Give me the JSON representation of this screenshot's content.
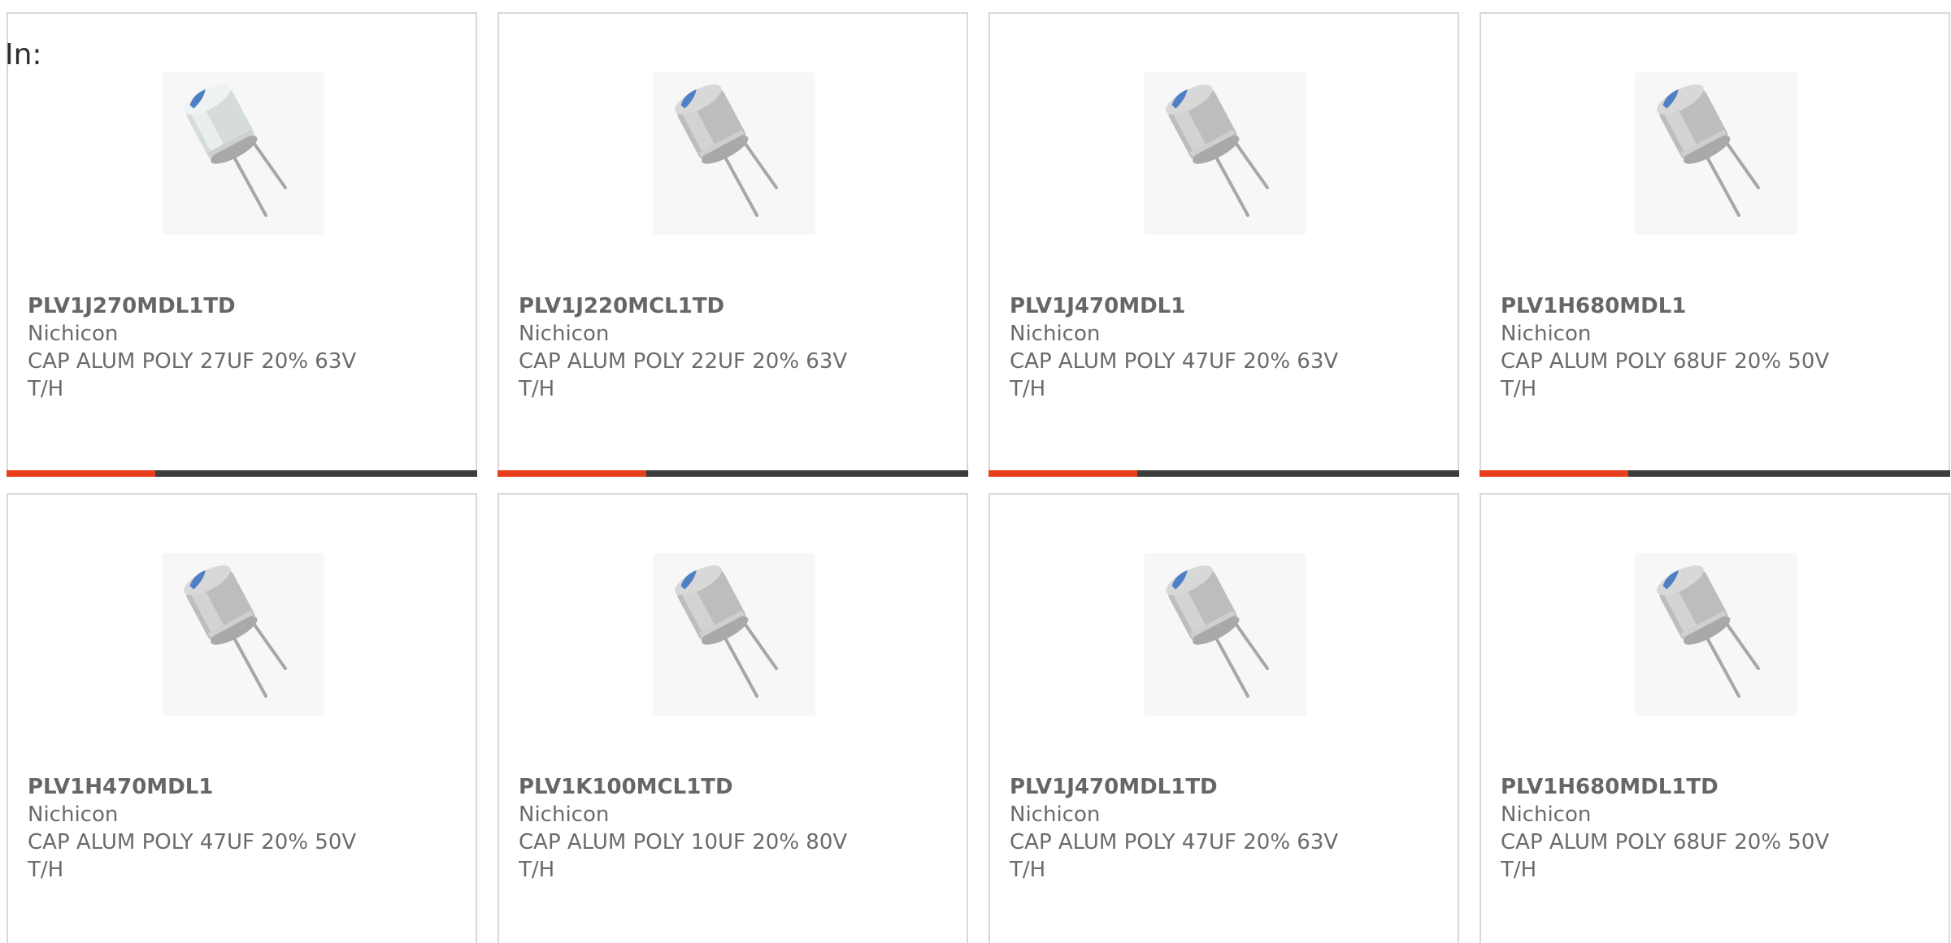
{
  "header": {
    "label": "In:"
  },
  "accent_color": "#e8401c",
  "bar_color": "#3d3d3d",
  "rows": [
    [
      {
        "part": "PLV1J270MDL1TD",
        "maker": "Nichicon",
        "desc": "CAP ALUM POLY 27UF 20% 63V",
        "mount": "T/H",
        "icon": "capacitor-image",
        "sleeve": "light"
      },
      {
        "part": "PLV1J220MCL1TD",
        "maker": "Nichicon",
        "desc": "CAP ALUM POLY 22UF 20% 63V",
        "mount": "T/H",
        "icon": "capacitor-image",
        "sleeve": "gray"
      },
      {
        "part": "PLV1J470MDL1",
        "maker": "Nichicon",
        "desc": "CAP ALUM POLY 47UF 20% 63V",
        "mount": "T/H",
        "icon": "capacitor-image",
        "sleeve": "gray"
      },
      {
        "part": "PLV1H680MDL1",
        "maker": "Nichicon",
        "desc": "CAP ALUM POLY 68UF 20% 50V",
        "mount": "T/H",
        "icon": "capacitor-image",
        "sleeve": "gray"
      }
    ],
    [
      {
        "part": "PLV1H470MDL1",
        "maker": "Nichicon",
        "desc": "CAP ALUM POLY 47UF 20% 50V",
        "mount": "T/H",
        "icon": "capacitor-image",
        "sleeve": "gray"
      },
      {
        "part": "PLV1K100MCL1TD",
        "maker": "Nichicon",
        "desc": "CAP ALUM POLY 10UF 20% 80V",
        "mount": "T/H",
        "icon": "capacitor-image",
        "sleeve": "gray"
      },
      {
        "part": "PLV1J470MDL1TD",
        "maker": "Nichicon",
        "desc": "CAP ALUM POLY 47UF 20% 63V",
        "mount": "T/H",
        "icon": "capacitor-image",
        "sleeve": "gray"
      },
      {
        "part": "PLV1H680MDL1TD",
        "maker": "Nichicon",
        "desc": "CAP ALUM POLY 68UF 20% 50V",
        "mount": "T/H",
        "icon": "capacitor-image",
        "sleeve": "gray"
      }
    ]
  ]
}
